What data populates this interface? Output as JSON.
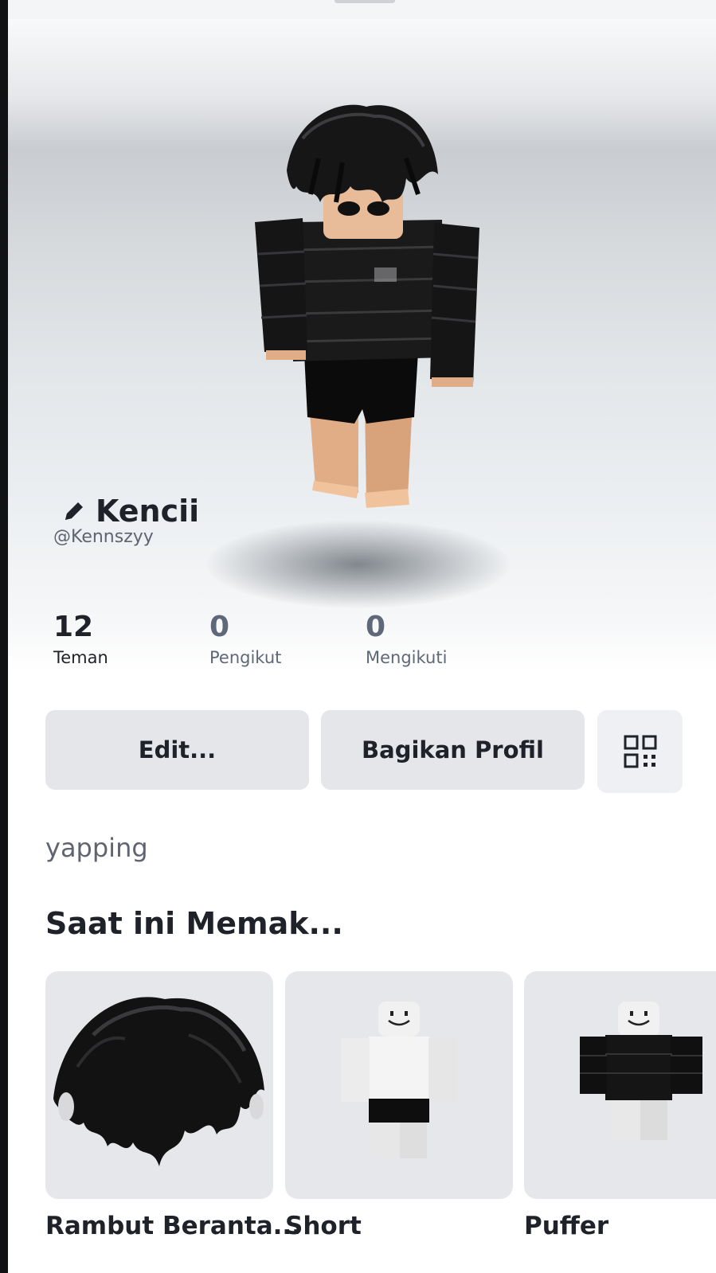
{
  "profile": {
    "display_name": "Kencii",
    "username": "@Kennszyy",
    "bio": "yapping"
  },
  "stats": [
    {
      "value": "12",
      "label": "Teman"
    },
    {
      "value": "0",
      "label": "Pengikut"
    },
    {
      "value": "0",
      "label": "Mengikuti"
    }
  ],
  "actions": {
    "edit_label": "Edit...",
    "share_label": "Bagikan Profil",
    "qr_icon": "qr-code-icon"
  },
  "wearing": {
    "title": "Saat ini Memak...",
    "items": [
      {
        "name": "Rambut Beranta...",
        "icon": "hair-item-image"
      },
      {
        "name": "Short",
        "icon": "shorts-item-image"
      },
      {
        "name": "Puffer",
        "icon": "puffer-item-image"
      }
    ]
  },
  "colors": {
    "button_bg": "#e4e6ea",
    "card_bg": "#e6e7eb",
    "text_primary": "#1f2228",
    "text_secondary": "#5f6878"
  }
}
